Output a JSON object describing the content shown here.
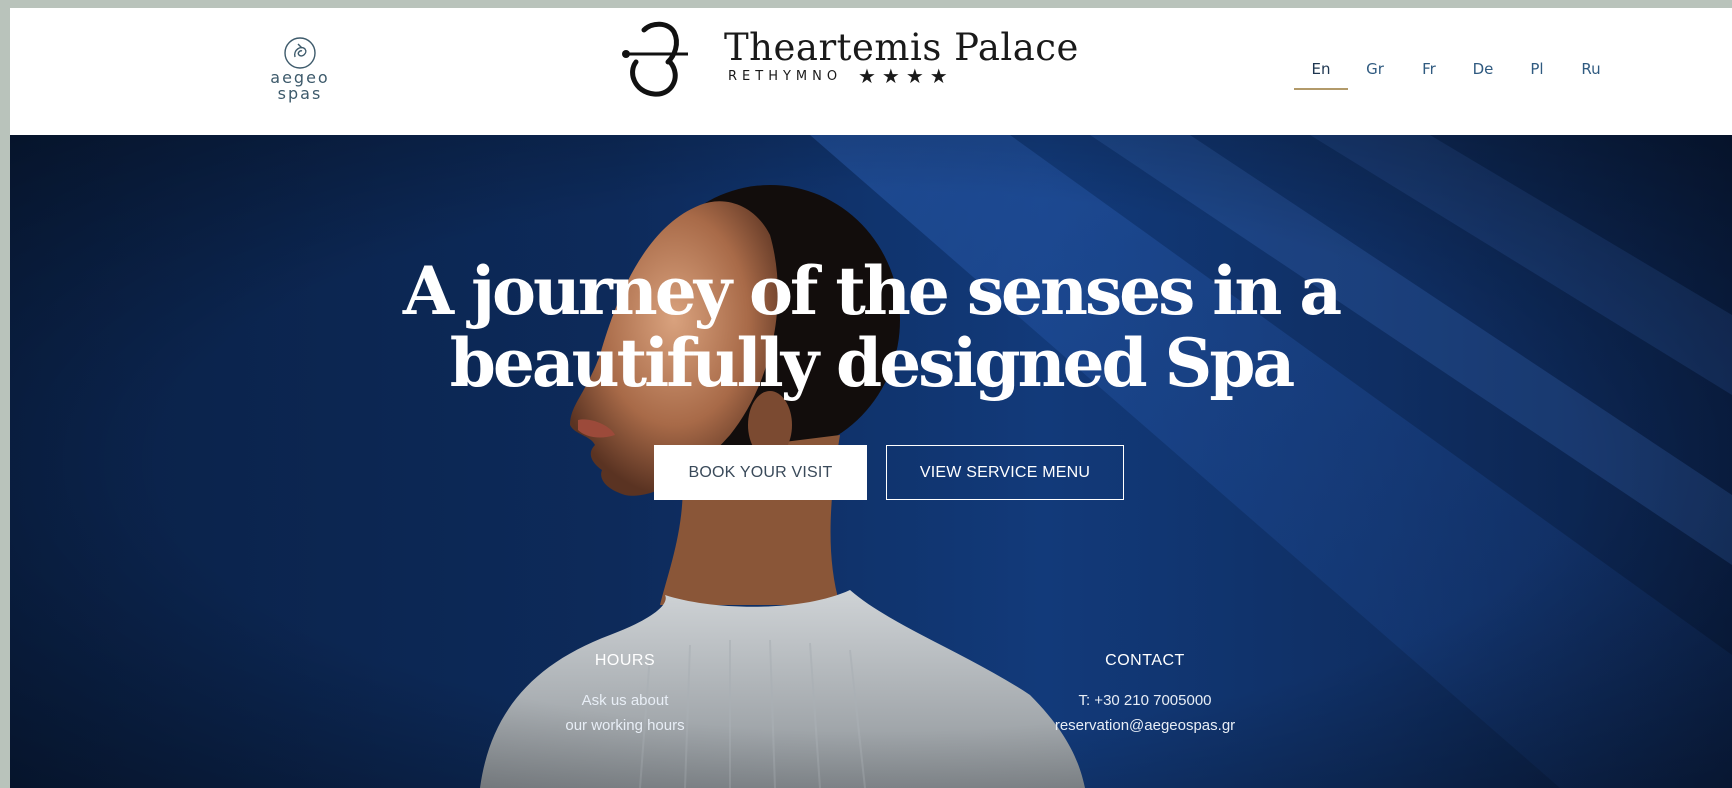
{
  "header": {
    "spa_logo": {
      "line1": "aegeo",
      "line2": "spas",
      "icon": "spa-swirl-icon"
    },
    "hotel_logo": {
      "name": "Theartemis Palace",
      "city": "RETHYMNO",
      "stars": "★★★★",
      "icon": "hotel-monogram-icon"
    },
    "languages": [
      {
        "label": "En",
        "active": true
      },
      {
        "label": "Gr",
        "active": false
      },
      {
        "label": "Fr",
        "active": false
      },
      {
        "label": "De",
        "active": false
      },
      {
        "label": "Pl",
        "active": false
      },
      {
        "label": "Ru",
        "active": false
      }
    ]
  },
  "hero": {
    "headline_line1": "A journey of the senses in a",
    "headline_line2": "beautifully designed Spa",
    "book_button": "BOOK YOUR VISIT",
    "menu_button": "VIEW SERVICE MENU",
    "hours": {
      "title": "HOURS",
      "line1": "Ask us about",
      "line2": "our working hours"
    },
    "contact": {
      "title": "CONTACT",
      "phone": "T: +30 210 7005000",
      "email": "reservation@aegeospas.gr"
    }
  },
  "colors": {
    "accent_underline": "#b29a6a",
    "lang_text": "#2f5a80",
    "hero_blue": "#0d2a5a"
  }
}
